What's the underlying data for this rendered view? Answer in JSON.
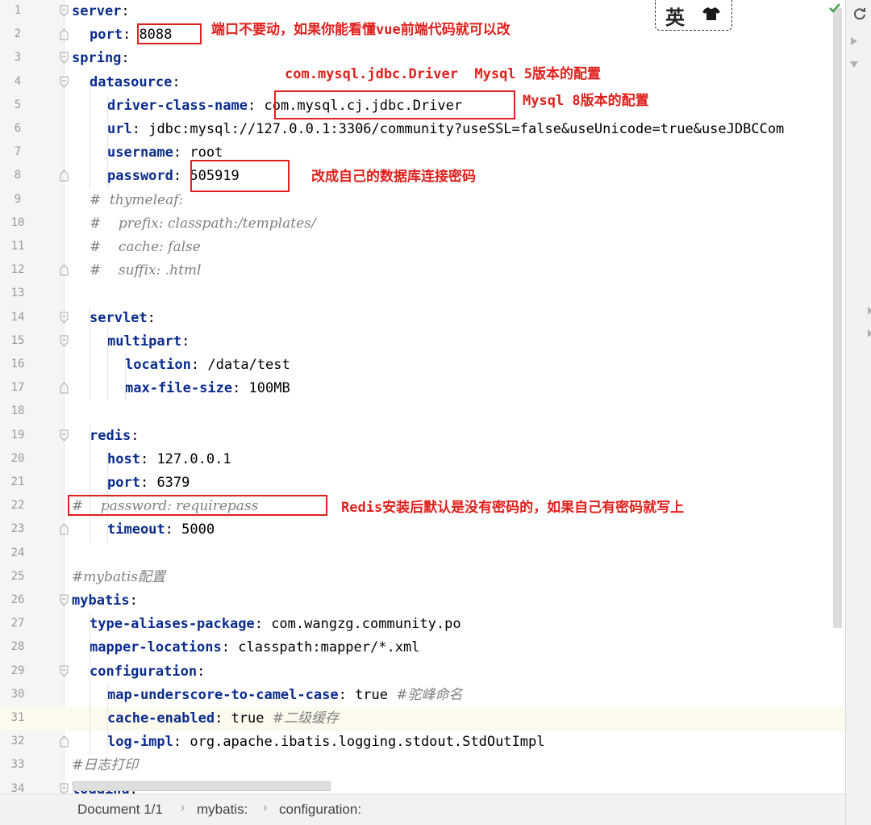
{
  "lines": [
    {
      "n": "1",
      "indent": 0,
      "key": "server",
      "sep": ":",
      "val": "",
      "comment": ""
    },
    {
      "n": "2",
      "indent": 1,
      "key": "port",
      "sep": ": ",
      "val": "8088",
      "comment": ""
    },
    {
      "n": "3",
      "indent": 0,
      "key": "spring",
      "sep": ":",
      "val": "",
      "comment": ""
    },
    {
      "n": "4",
      "indent": 1,
      "key": "datasource",
      "sep": ":",
      "val": "",
      "comment": ""
    },
    {
      "n": "5",
      "indent": 2,
      "key": "driver-class-name",
      "sep": ": ",
      "val": "com.mysql.cj.jdbc.Driver",
      "comment": ""
    },
    {
      "n": "6",
      "indent": 2,
      "key": "url",
      "sep": ": ",
      "val": "jdbc:mysql://127.0.0.1:3306/community?useSSL=false&useUnicode=true&useJDBCCom",
      "comment": ""
    },
    {
      "n": "7",
      "indent": 2,
      "key": "username",
      "sep": ": ",
      "val": "root",
      "comment": ""
    },
    {
      "n": "8",
      "indent": 2,
      "key": "password",
      "sep": ": ",
      "val": "505919",
      "comment": ""
    },
    {
      "n": "9",
      "indent": 1,
      "key": "",
      "sep": "",
      "val": "",
      "comment": "#  thymeleaf:"
    },
    {
      "n": "10",
      "indent": 1,
      "key": "",
      "sep": "",
      "val": "",
      "comment": "#    prefix: classpath:/templates/"
    },
    {
      "n": "11",
      "indent": 1,
      "key": "",
      "sep": "",
      "val": "",
      "comment": "#    cache: false"
    },
    {
      "n": "12",
      "indent": 1,
      "key": "",
      "sep": "",
      "val": "",
      "comment": "#    suffix: .html"
    },
    {
      "n": "13",
      "indent": 0,
      "key": "",
      "sep": "",
      "val": "",
      "comment": ""
    },
    {
      "n": "14",
      "indent": 1,
      "key": "servlet",
      "sep": ":",
      "val": "",
      "comment": ""
    },
    {
      "n": "15",
      "indent": 2,
      "key": "multipart",
      "sep": ":",
      "val": "",
      "comment": ""
    },
    {
      "n": "16",
      "indent": 3,
      "key": "location",
      "sep": ": ",
      "val": "/data/test",
      "comment": ""
    },
    {
      "n": "17",
      "indent": 3,
      "key": "max-file-size",
      "sep": ": ",
      "val": "100MB",
      "comment": ""
    },
    {
      "n": "18",
      "indent": 0,
      "key": "",
      "sep": "",
      "val": "",
      "comment": ""
    },
    {
      "n": "19",
      "indent": 1,
      "key": "redis",
      "sep": ":",
      "val": "",
      "comment": ""
    },
    {
      "n": "20",
      "indent": 2,
      "key": "host",
      "sep": ": ",
      "val": "127.0.0.1",
      "comment": ""
    },
    {
      "n": "21",
      "indent": 2,
      "key": "port",
      "sep": ": ",
      "val": "6379",
      "comment": ""
    },
    {
      "n": "22",
      "indent": 0,
      "key": "",
      "sep": "",
      "val": "",
      "comment": "#    password: requirepass"
    },
    {
      "n": "23",
      "indent": 2,
      "key": "timeout",
      "sep": ": ",
      "val": "5000",
      "comment": ""
    },
    {
      "n": "24",
      "indent": 0,
      "key": "",
      "sep": "",
      "val": "",
      "comment": ""
    },
    {
      "n": "25",
      "indent": 0,
      "key": "",
      "sep": "",
      "val": "",
      "comment": "#mybatis配置"
    },
    {
      "n": "26",
      "indent": 0,
      "key": "mybatis",
      "sep": ":",
      "val": "",
      "comment": ""
    },
    {
      "n": "27",
      "indent": 1,
      "key": "type-aliases-package",
      "sep": ": ",
      "val": "com.wangzg.community.po",
      "comment": ""
    },
    {
      "n": "28",
      "indent": 1,
      "key": "mapper-locations",
      "sep": ": ",
      "val": "classpath:mapper/*.xml",
      "comment": ""
    },
    {
      "n": "29",
      "indent": 1,
      "key": "configuration",
      "sep": ":",
      "val": "",
      "comment": ""
    },
    {
      "n": "30",
      "indent": 2,
      "key": "map-underscore-to-camel-case",
      "sep": ": ",
      "val": "true ",
      "comment": "#驼峰命名"
    },
    {
      "n": "31",
      "indent": 2,
      "key": "cache-enabled",
      "sep": ": ",
      "val": "true ",
      "comment": "#二级缓存"
    },
    {
      "n": "32",
      "indent": 2,
      "key": "log-impl",
      "sep": ": ",
      "val": "org.apache.ibatis.logging.stdout.StdOutImpl",
      "comment": ""
    },
    {
      "n": "33",
      "indent": 0,
      "key": "",
      "sep": "",
      "val": "",
      "comment": "#日志打印"
    },
    {
      "n": "34",
      "indent": 0,
      "key": "logging",
      "sep": ":",
      "val": "",
      "comment": ""
    }
  ],
  "annotations": {
    "port_note": "端口不要动，如果你能看懂vue前端代码就可以改",
    "mysql5_note": "com.mysql.jdbc.Driver  Mysql 5版本的配置",
    "mysql8_note": "Mysql 8版本的配置",
    "password_note": "改成自己的数据库连接密码",
    "redis_note": "Redis安装后默认是没有密码的，如果自己有密码就写上"
  },
  "badge": {
    "char": "英"
  },
  "status_bar": {
    "doc": "Document 1/1",
    "crumbs": [
      "mybatis:",
      "configuration:"
    ]
  },
  "colors": {
    "key": "#0b2c8f",
    "annotation": "#e0201c",
    "comment": "#808080",
    "current_line": "#fcfaed"
  }
}
